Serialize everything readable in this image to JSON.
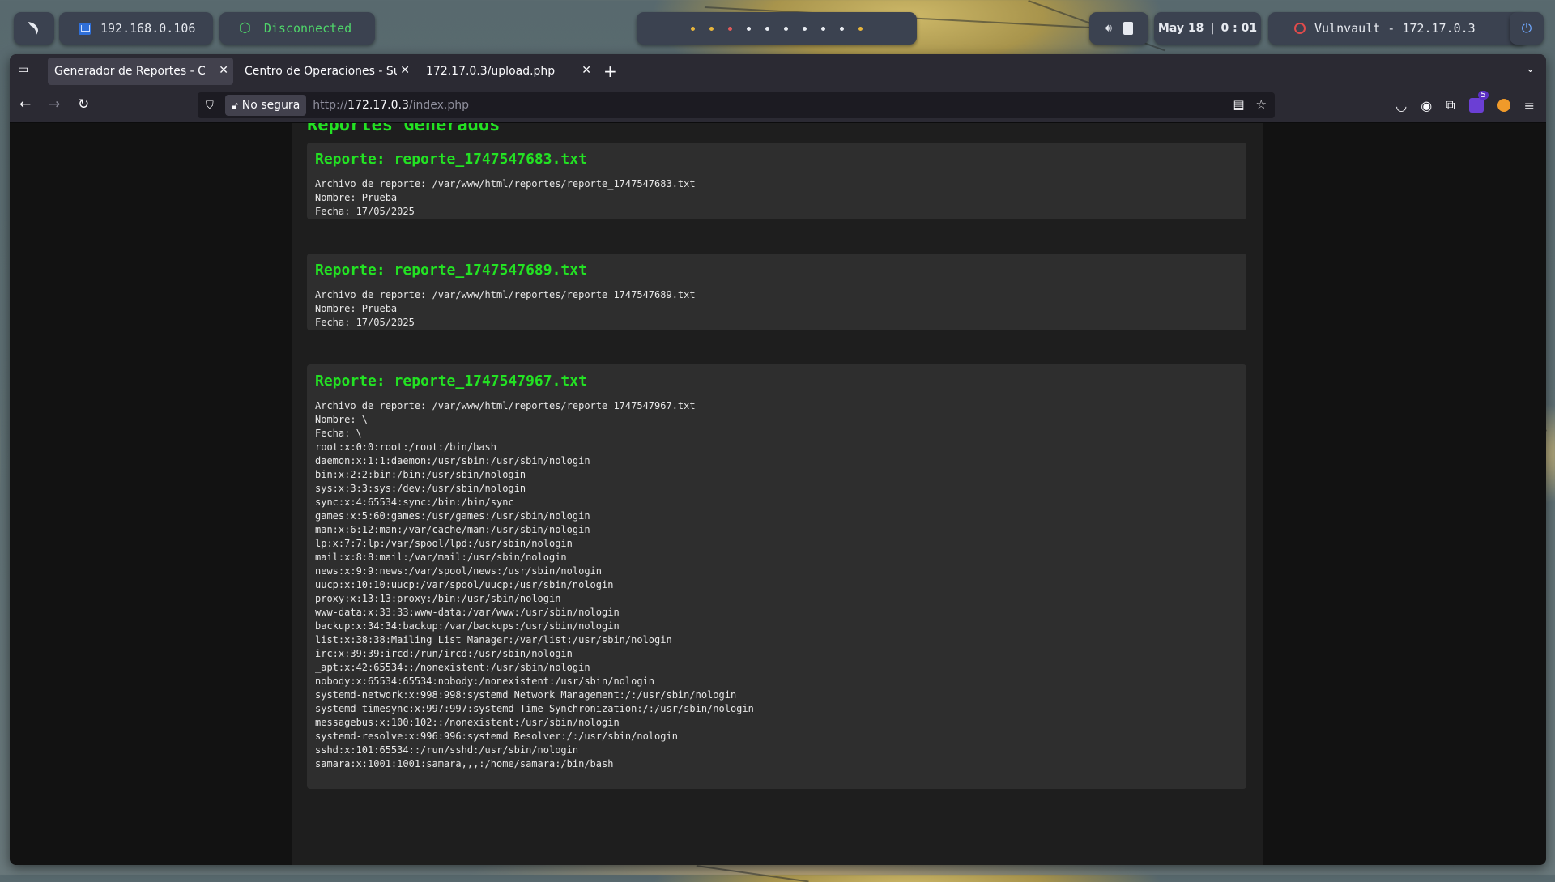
{
  "desktop_bar": {
    "ip": "192.168.0.106",
    "vpn_status": "Disconnected",
    "date": "May 18",
    "time": "0 : 01",
    "target": "Vulnvault - 172.17.0.3",
    "colors": {
      "vpn_green": "#4fd66a",
      "target_red": "#e04b4b",
      "power_blue": "#6fa8ff"
    }
  },
  "browser": {
    "tabs": [
      {
        "title": "Generador de Reportes - Centro",
        "active": true
      },
      {
        "title": "Centro de Operaciones - Sub",
        "active": false
      },
      {
        "title": "172.17.0.3/upload.php",
        "active": false
      }
    ],
    "url_security_label": "No segura",
    "url_prefix": "http://",
    "url_host": "172.17.0.3",
    "url_path": "/index.php",
    "extension_badge_count": "5"
  },
  "page": {
    "section_title": "Reportes Generados",
    "accent_color": "#23e223",
    "reports": [
      {
        "title": "Reporte: reporte_1747547683.txt",
        "body": "Archivo de reporte: /var/www/html/reportes/reporte_1747547683.txt\nNombre: Prueba\nFecha: 17/05/2025"
      },
      {
        "title": "Reporte: reporte_1747547689.txt",
        "body": "Archivo de reporte: /var/www/html/reportes/reporte_1747547689.txt\nNombre: Prueba\nFecha: 17/05/2025"
      },
      {
        "title": "Reporte: reporte_1747547967.txt",
        "body": "Archivo de reporte: /var/www/html/reportes/reporte_1747547967.txt\nNombre: \\\nFecha: \\\nroot:x:0:0:root:/root:/bin/bash\ndaemon:x:1:1:daemon:/usr/sbin:/usr/sbin/nologin\nbin:x:2:2:bin:/bin:/usr/sbin/nologin\nsys:x:3:3:sys:/dev:/usr/sbin/nologin\nsync:x:4:65534:sync:/bin:/bin/sync\ngames:x:5:60:games:/usr/games:/usr/sbin/nologin\nman:x:6:12:man:/var/cache/man:/usr/sbin/nologin\nlp:x:7:7:lp:/var/spool/lpd:/usr/sbin/nologin\nmail:x:8:8:mail:/var/mail:/usr/sbin/nologin\nnews:x:9:9:news:/var/spool/news:/usr/sbin/nologin\nuucp:x:10:10:uucp:/var/spool/uucp:/usr/sbin/nologin\nproxy:x:13:13:proxy:/bin:/usr/sbin/nologin\nwww-data:x:33:33:www-data:/var/www:/usr/sbin/nologin\nbackup:x:34:34:backup:/var/backups:/usr/sbin/nologin\nlist:x:38:38:Mailing List Manager:/var/list:/usr/sbin/nologin\nirc:x:39:39:ircd:/run/ircd:/usr/sbin/nologin\n_apt:x:42:65534::/nonexistent:/usr/sbin/nologin\nnobody:x:65534:65534:nobody:/nonexistent:/usr/sbin/nologin\nsystemd-network:x:998:998:systemd Network Management:/:/usr/sbin/nologin\nsystemd-timesync:x:997:997:systemd Time Synchronization:/:/usr/sbin/nologin\nmessagebus:x:100:102::/nonexistent:/usr/sbin/nologin\nsystemd-resolve:x:996:996:systemd Resolver:/:/usr/sbin/nologin\nsshd:x:101:65534::/run/sshd:/usr/sbin/nologin\nsamara:x:1001:1001:samara,,,:/home/samara:/bin/bash"
      }
    ]
  }
}
